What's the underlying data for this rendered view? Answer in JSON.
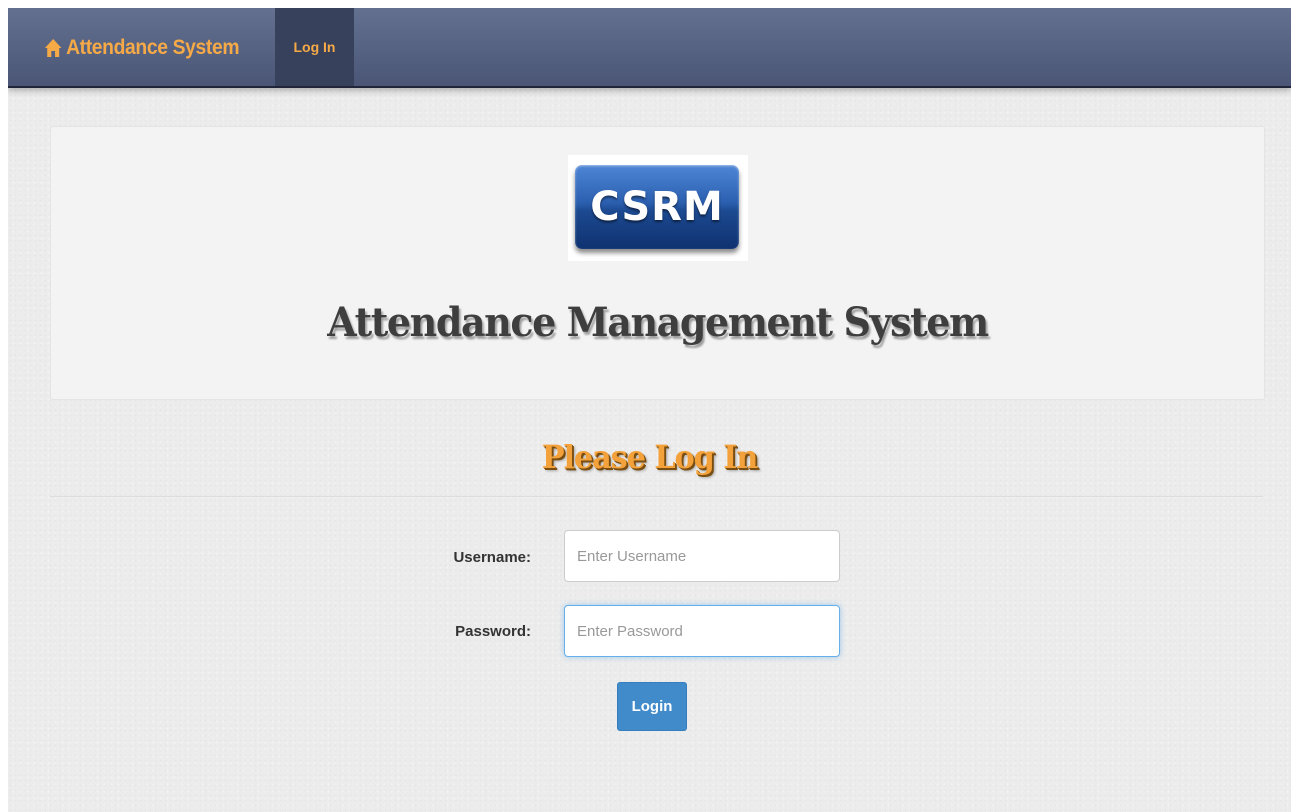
{
  "navbar": {
    "brand": "Attendance System",
    "brand_icon": "home-icon",
    "login_link": "Log In"
  },
  "jumbotron": {
    "logo_text": "CSRM",
    "title": "Attendance Management System"
  },
  "login_form": {
    "heading": "Please Log In",
    "username_label": "Username:",
    "username_placeholder": "Enter Username",
    "password_label": "Password:",
    "password_placeholder": "Enter Password",
    "submit_label": "Login"
  },
  "colors": {
    "navbar": "#55607f",
    "accent_orange": "#f6a947",
    "button_blue": "#428bca",
    "focus_blue": "#66afe9"
  }
}
